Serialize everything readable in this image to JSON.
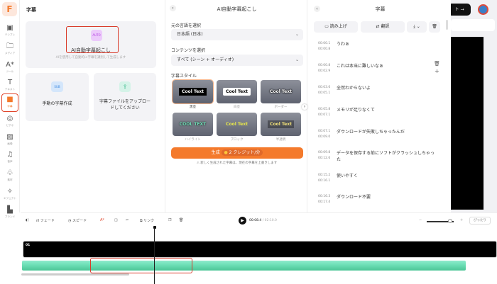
{
  "sidebar": {
    "logo": "F",
    "items": [
      {
        "label": "テンプレ",
        "icon": "template-icon"
      },
      {
        "label": "メディア",
        "icon": "folder-icon"
      },
      {
        "label": "ツール",
        "icon": "ai-tools-icon"
      },
      {
        "label": "テキスト",
        "icon": "text-icon"
      },
      {
        "label": "字幕",
        "icon": "subtitle-icon",
        "active": true
      },
      {
        "label": "ビデオ",
        "icon": "video-icon"
      },
      {
        "label": "画像",
        "icon": "image-icon"
      },
      {
        "label": "音声",
        "icon": "music-icon"
      },
      {
        "label": "素材",
        "icon": "elements-icon"
      },
      {
        "label": "エフェクト",
        "icon": "effects-icon"
      },
      {
        "label": "ブランド",
        "icon": "brand-icon"
      }
    ]
  },
  "left_panel": {
    "title": "字幕",
    "auto": {
      "badge": "AUTO",
      "title": "AI自動字幕起こし",
      "desc": "AIを使用して自動的に字幕を識別して生成します"
    },
    "manual": {
      "badge": "SUB",
      "title": "手動の字幕作成"
    },
    "upload": {
      "title": "字幕ファイルをアップロードしてください"
    }
  },
  "mid_panel": {
    "title": "AI自動字幕起こし",
    "lang_label": "元の言語を選択",
    "lang_value": "日本語 (日本)",
    "content_label": "コンテンツを選択",
    "content_value": "すべて (シーン + オーディオ)",
    "style_label": "字幕スタイル",
    "styles": [
      {
        "text": "Cool Text",
        "name": "黒塗"
      },
      {
        "text": "Cool Text",
        "name": "白塗"
      },
      {
        "text": "Cool Text",
        "name": "ボーダー"
      },
      {
        "text": "COOL TEXT",
        "name": "ハイライト"
      },
      {
        "text": "Cool Text",
        "name": "ブロック"
      },
      {
        "text": "Cool Text",
        "name": "半透明"
      }
    ],
    "generate": "生成",
    "credits": "2 クレジット/分",
    "warning": "新しく生成された字幕は、現在の字幕を上書きします"
  },
  "right_panel": {
    "title": "字幕",
    "read_aloud": "読み上げ",
    "translate": "翻訳",
    "subtitles": [
      {
        "start": "00:00.1",
        "end": "00:00.8",
        "text": "うわぁ"
      },
      {
        "start": "00:00.8",
        "end": "00:02.9",
        "text": "これは本当に難しいなぁ"
      },
      {
        "start": "00:03.6",
        "end": "00:05.1",
        "text": "全然わからないよ"
      },
      {
        "start": "00:05.8",
        "end": "00:07.1",
        "text": "メモリが足りなくて"
      },
      {
        "start": "00:07.1",
        "end": "00:09.0",
        "text": "ダウンロードが失敗しちゃったんだ"
      },
      {
        "start": "00:09.8",
        "end": "00:12.6",
        "text": "データを保存する前にソフトがクラッシュしちゃった"
      },
      {
        "start": "00:15.2",
        "end": "00:16.1",
        "text": "使いやすく"
      },
      {
        "start": "00:16.3",
        "end": "00:17.4",
        "text": "ダウンロード不要"
      }
    ]
  },
  "header": {
    "export": "ト →"
  },
  "timeline": {
    "fade": "フェード",
    "speed": "スピード",
    "link": "リンク",
    "current": "00:08.4",
    "total": "02:10.0",
    "fit": "ぴったり",
    "track_label": "01"
  },
  "colors": {
    "accent": "#f47a2c",
    "highlight": "#d93a2a",
    "audio": "#6fe0b8"
  }
}
